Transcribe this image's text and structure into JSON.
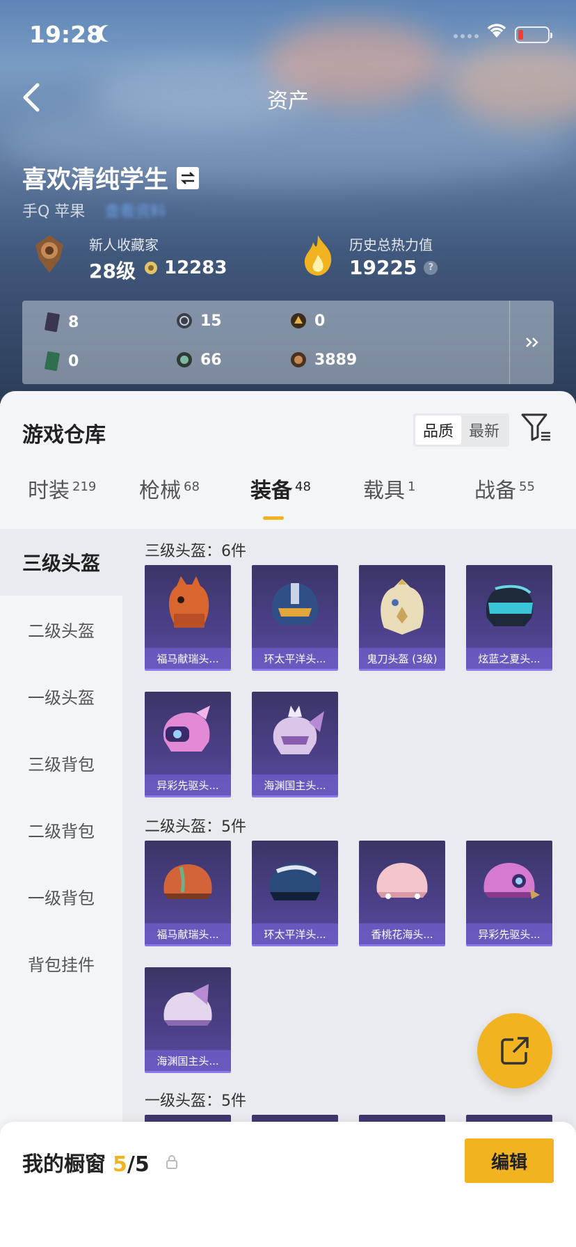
{
  "status": {
    "time": "19:28"
  },
  "header": {
    "title": "资产"
  },
  "profile": {
    "name": "喜欢清纯学生",
    "platform": "手Q 苹果",
    "blurred_link": "查看资料",
    "collector_label": "新人收藏家",
    "level": "28级",
    "coins": "12283",
    "heat_label": "历史总热力值",
    "heat_value": "19225"
  },
  "resources": [
    {
      "icon": "dark-card-icon",
      "value": "8"
    },
    {
      "icon": "silver-coin-icon",
      "value": "15"
    },
    {
      "icon": "gold-coin-icon",
      "value": "0"
    },
    {
      "icon": "green-card-icon",
      "value": "0"
    },
    {
      "icon": "green-coin-icon",
      "value": "66"
    },
    {
      "icon": "bronze-coin-icon",
      "value": "3889"
    }
  ],
  "warehouse": {
    "title": "游戏仓库",
    "sort_options": [
      "品质",
      "最新"
    ],
    "selected_sort": "品质"
  },
  "tabs": [
    {
      "label": "时装",
      "count": "219"
    },
    {
      "label": "枪械",
      "count": "68"
    },
    {
      "label": "装备",
      "count": "48"
    },
    {
      "label": "载具",
      "count": "1"
    },
    {
      "label": "战备",
      "count": "55"
    }
  ],
  "active_tab": "装备",
  "side_menu": [
    "三级头盔",
    "二级头盔",
    "一级头盔",
    "三级背包",
    "二级背包",
    "一级背包",
    "背包挂件"
  ],
  "active_side": "三级头盔",
  "sections": [
    {
      "title": "三级头盔：6件",
      "items": [
        "福马献瑞头...",
        "环太平洋头...",
        "鬼刀头盔 (3级)",
        "炫蓝之夏头...",
        "异彩先驱头...",
        "海渊国主头..."
      ]
    },
    {
      "title": "二级头盔：5件",
      "items": [
        "福马献瑞头...",
        "环太平洋头...",
        "香桃花海头...",
        "异彩先驱头...",
        "海渊国主头..."
      ]
    },
    {
      "title": "一级头盔：5件",
      "items": []
    }
  ],
  "showcase": {
    "label": "我的橱窗",
    "current": "5",
    "total": "/5",
    "edit_label": "编辑"
  },
  "colors": {
    "accent": "#f2b321",
    "card": "#4a3f86",
    "card_caption": "#6c5cc4"
  }
}
